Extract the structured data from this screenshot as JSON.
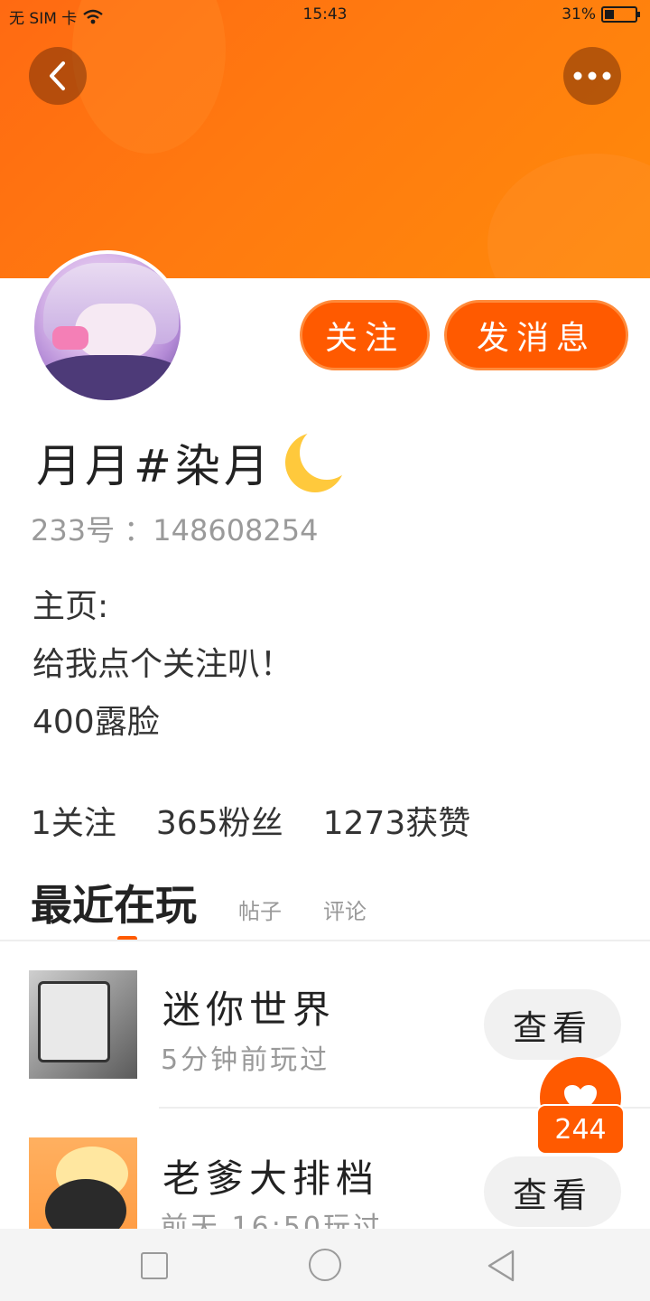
{
  "status_bar": {
    "carrier": "无 SIM 卡",
    "time": "15:43",
    "battery": "31%",
    "battery_level": 0.31
  },
  "header": {
    "back_icon": "chevron-left-icon",
    "more_icon": "more-horizontal-icon",
    "banner_color": "#ff7a10"
  },
  "profile": {
    "name": "月月#染月",
    "id_label": "233号 ：148608254",
    "bio_lines": [
      "主页:",
      "给我点个关注叭！",
      "400露脸"
    ],
    "follow_label": "关注",
    "message_label": "发消息",
    "accent": "#ff5a00"
  },
  "stats": {
    "following": "1关注",
    "fans": "365粉丝",
    "likes": "1273获赞"
  },
  "tabs": [
    {
      "label": "最近在玩",
      "active": true
    },
    {
      "label": "帖子",
      "active": false
    },
    {
      "label": "评论",
      "active": false
    }
  ],
  "games": [
    {
      "title": "迷你世界",
      "subtitle": "5分钟前玩过",
      "button": "查看"
    },
    {
      "title": "老爹大排档",
      "subtitle": "前天 16:50玩过",
      "button": "查看"
    }
  ],
  "like_fab": {
    "icon": "heart-icon",
    "count": "244"
  },
  "nav": {
    "recent_icon": "square-icon",
    "home_icon": "circle-icon",
    "back_icon": "triangle-back-icon"
  }
}
